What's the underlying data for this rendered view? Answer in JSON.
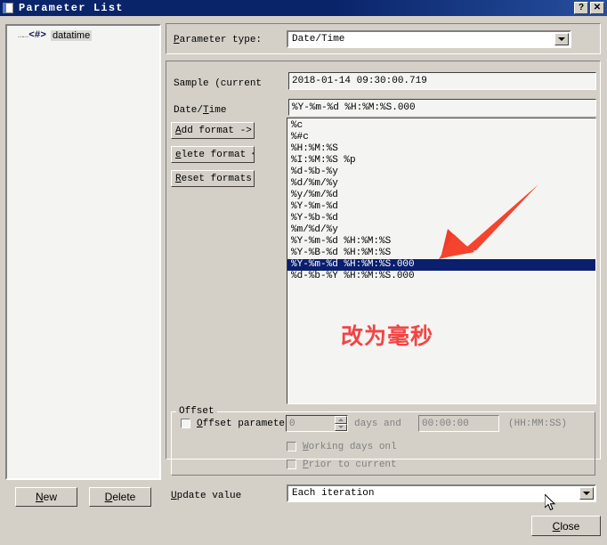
{
  "window": {
    "title": "Parameter List",
    "icon": "document-icon",
    "help_button": "?",
    "close_button": "✕"
  },
  "tree": {
    "dots": "…",
    "items": [
      {
        "marker": "<#>",
        "label": "datatime"
      }
    ]
  },
  "bottom_buttons": {
    "new": {
      "accel": "N",
      "rest": "ew"
    },
    "delete": {
      "accel": "D",
      "rest": "elete"
    },
    "close": {
      "accel": "C",
      "rest": "lose"
    }
  },
  "parameter_type": {
    "label_accel": "P",
    "label_rest": "arameter type:",
    "value": "Date/Time",
    "arrow_icon": "chevron-down-icon"
  },
  "sample": {
    "label": "Sample (current",
    "value": "2018-01-14 09:30:00.719"
  },
  "datetime": {
    "label_pre": "Date/",
    "label_accel": "T",
    "label_rest": "ime",
    "value": "%Y-%m-%d %H:%M:%S.000"
  },
  "format_buttons": [
    {
      "accel": "A",
      "rest": "dd format ->"
    },
    {
      "accel": "e",
      "rest": "lete format <"
    },
    {
      "accel": "R",
      "rest": "eset formats"
    }
  ],
  "format_list": {
    "items": [
      "%c",
      "%#c",
      "%H:%M:%S",
      "%I:%M:%S %p",
      "%d-%b-%y",
      "%d/%m/%y",
      "%y/%m/%d",
      "%Y-%m-%d",
      "%Y-%b-%d",
      "%m/%d/%y",
      "%Y-%m-%d %H:%M:%S",
      "%Y-%B-%d %H:%M:%S",
      "%Y-%m-%d %H:%M:%S.000",
      "%d-%b-%Y %H:%M:%S.000"
    ],
    "selected_index": 12
  },
  "offset": {
    "group_label": "Offset",
    "checkbox_accel": "O",
    "checkbox_rest": "ffset parameter",
    "days_value": "0",
    "days_label": "days and",
    "time_value": "00:00:00",
    "time_hint": "(HH:MM:SS)",
    "working_days": {
      "accel": "W",
      "rest": "orking days onl"
    },
    "prior_to_current": {
      "accel": "P",
      "rest": "rior to current"
    }
  },
  "update_value": {
    "label_accel": "U",
    "label_rest": "pdate value",
    "value": "Each iteration",
    "arrow_icon": "chevron-down-icon"
  },
  "annotations": {
    "text": "改为毫秒",
    "arrow_color": "#f03c28",
    "text_color": "#f24444"
  }
}
